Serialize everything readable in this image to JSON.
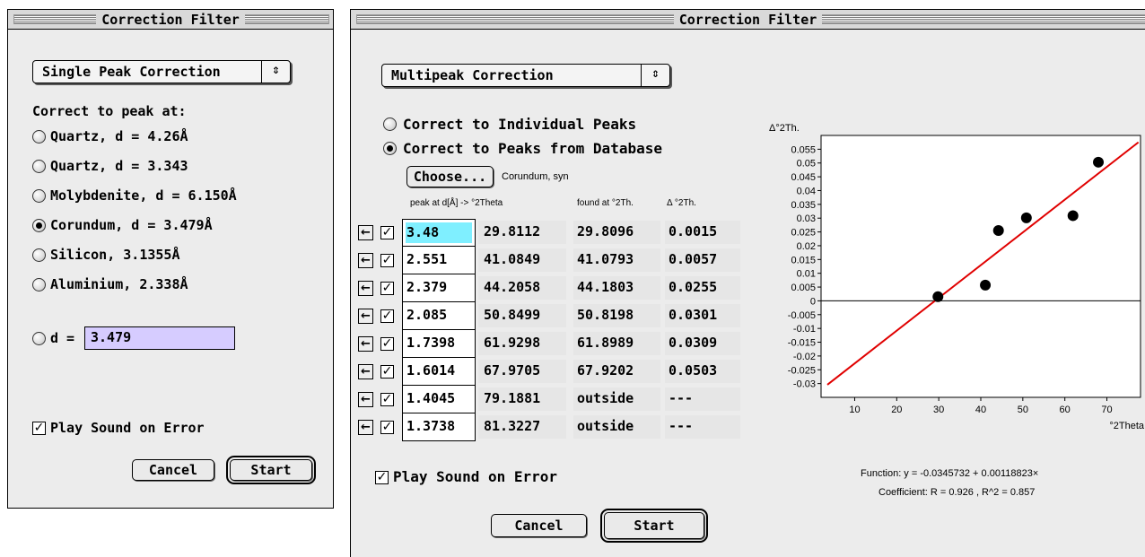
{
  "small_window": {
    "title": "Correction Filter",
    "popup_label": "Single Peak Correction",
    "prompt": "Correct to peak at:",
    "options": [
      {
        "label": "Quartz, d = 4.26Å",
        "selected": false
      },
      {
        "label": "Quartz, d = 3.343",
        "selected": false
      },
      {
        "label": "Molybdenite, d = 6.150Å",
        "selected": false
      },
      {
        "label": "Corundum, d = 3.479Å",
        "selected": true
      },
      {
        "label": "Silicon, 3.1355Å",
        "selected": false
      },
      {
        "label": "Aluminium, 2.338Å",
        "selected": false
      }
    ],
    "custom_d_label": "d =",
    "custom_d_value": "3.479",
    "play_sound_label": "Play Sound on Error",
    "play_sound_checked": true,
    "cancel_label": "Cancel",
    "start_label": "Start"
  },
  "large_window": {
    "title": "Correction Filter",
    "popup_label": "Multipeak Correction",
    "radio_individual_label": "Correct to Individual Peaks",
    "radio_database_label": "Correct to Peaks from Database",
    "choose_label": "Choose...",
    "database_name": "Corundum, syn",
    "table_headers": {
      "peak": "peak at d[Å] -> °2Theta",
      "found": "found at °2Th.",
      "delta": "Δ °2Th."
    },
    "table_rows": [
      {
        "d": "3.48",
        "theta": "29.8112",
        "found": "29.8096",
        "delta": "0.0015",
        "selected": true
      },
      {
        "d": "2.551",
        "theta": "41.0849",
        "found": "41.0793",
        "delta": "0.0057"
      },
      {
        "d": "2.379",
        "theta": "44.2058",
        "found": "44.1803",
        "delta": "0.0255"
      },
      {
        "d": "2.085",
        "theta": "50.8499",
        "found": "50.8198",
        "delta": "0.0301"
      },
      {
        "d": "1.7398",
        "theta": "61.9298",
        "found": "61.8989",
        "delta": "0.0309"
      },
      {
        "d": "1.6014",
        "theta": "67.9705",
        "found": "67.9202",
        "delta": "0.0503"
      },
      {
        "d": "1.4045",
        "theta": "79.1881",
        "found": "outside",
        "delta": "---"
      },
      {
        "d": "1.3738",
        "theta": "81.3227",
        "found": "outside",
        "delta": "---"
      }
    ],
    "play_sound_label": "Play Sound on Error",
    "play_sound_checked": true,
    "cancel_label": "Cancel",
    "start_label": "Start",
    "function_text": "Function: y = -0.0345732 + 0.00118823×",
    "coefficient_text": "Coefficient: R = 0.926 , R^2 = 0.857"
  },
  "chart_data": {
    "type": "scatter",
    "ylabel": "Δ°2Th.",
    "xlabel": "°2Theta",
    "xlim": [
      2,
      78
    ],
    "ylim": [
      -0.035,
      0.06
    ],
    "x_ticks": [
      10,
      20,
      30,
      40,
      50,
      60,
      70
    ],
    "y_ticks": [
      0.055,
      0.05,
      0.045,
      0.04,
      0.035,
      0.03,
      0.025,
      0.02,
      0.015,
      0.01,
      0.005,
      0,
      -0.005,
      -0.01,
      -0.015,
      -0.02,
      -0.025,
      -0.03
    ],
    "y_tick_labels": [
      "0.055",
      "0.05",
      "0.045",
      "0.04",
      "0.035",
      "0.03",
      "0.025",
      "0.02",
      "0.015",
      "0.01",
      "0.005",
      "0",
      "-0.005",
      "-0.01",
      "-0.015",
      "-0.02",
      "-0.025",
      "-0.03"
    ],
    "points": [
      {
        "x": 29.81,
        "y": 0.0015
      },
      {
        "x": 41.08,
        "y": 0.0057
      },
      {
        "x": 44.21,
        "y": 0.0255
      },
      {
        "x": 50.85,
        "y": 0.0301
      },
      {
        "x": 61.93,
        "y": 0.0309
      },
      {
        "x": 67.97,
        "y": 0.0503
      }
    ],
    "fit_line": {
      "intercept": -0.0345732,
      "slope": 0.00118823
    },
    "colors": {
      "points": "#000000",
      "fit": "#e00000",
      "axis": "#000000"
    }
  }
}
